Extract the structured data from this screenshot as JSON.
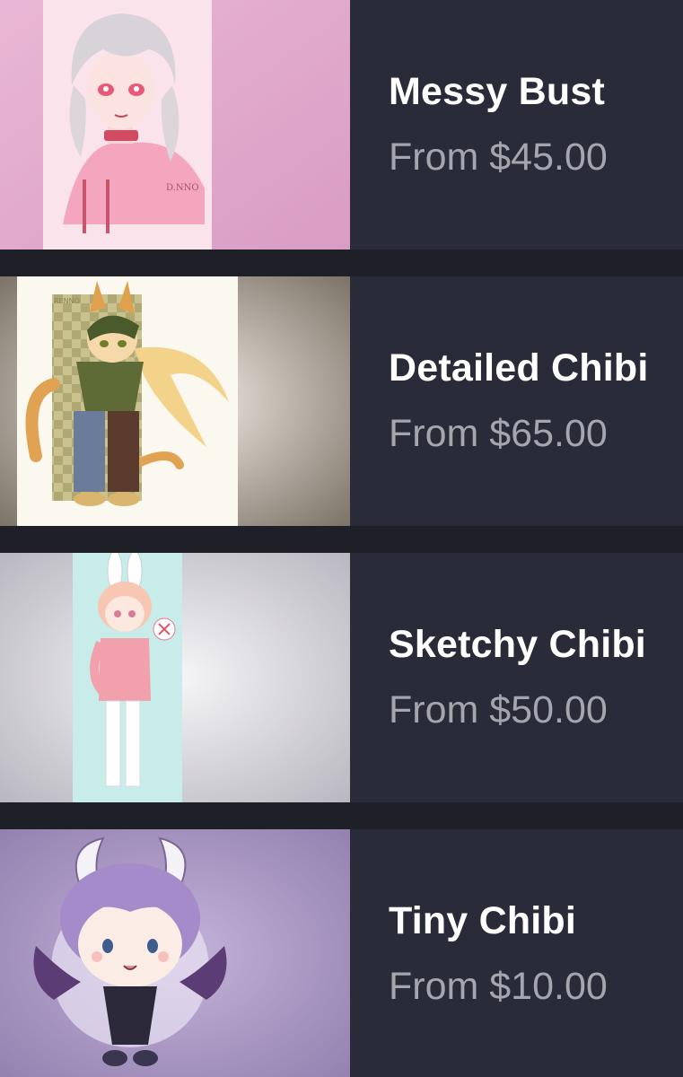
{
  "commissions": [
    {
      "name": "Messy Bust",
      "price": "From $45.00",
      "image": "messy-bust-artwork"
    },
    {
      "name": "Detailed Chibi",
      "price": "From $65.00",
      "image": "detailed-chibi-artwork"
    },
    {
      "name": "Sketchy Chibi",
      "price": "From $50.00",
      "image": "sketchy-chibi-artwork"
    },
    {
      "name": "Tiny Chibi",
      "price": "From $10.00",
      "image": "tiny-chibi-artwork"
    }
  ],
  "colors": {
    "background": "#20212a",
    "card": "#2a2b38",
    "title": "#ffffff",
    "price": "#a4a5ad"
  }
}
